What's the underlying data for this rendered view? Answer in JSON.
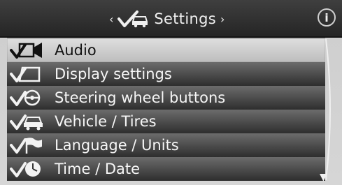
{
  "header": {
    "title": "Settings",
    "left_arrow": "‹",
    "right_arrow": "›",
    "icon": "car-settings-icon",
    "info_label": "i"
  },
  "menu": {
    "selected_index": 0,
    "items": [
      {
        "label": "Audio",
        "icon": "audio-icon"
      },
      {
        "label": "Display settings",
        "icon": "display-icon"
      },
      {
        "label": "Steering wheel buttons",
        "icon": "steering-wheel-icon"
      },
      {
        "label": "Vehicle / Tires",
        "icon": "vehicle-icon"
      },
      {
        "label": "Language / Units",
        "icon": "flag-icon"
      },
      {
        "label": "Time / Date",
        "icon": "clock-icon"
      }
    ]
  },
  "scroll": {
    "down_arrow": "▼"
  },
  "colors": {
    "header_bg": "#2b2b2b",
    "item_bg": "#3a3a3a",
    "selected_bg": "#d0d0d0",
    "text_light": "#f6f6f6",
    "text_dark": "#121212"
  }
}
